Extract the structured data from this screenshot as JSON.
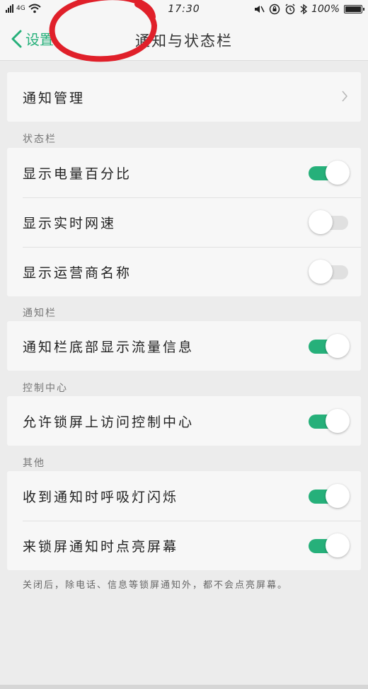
{
  "status_bar": {
    "time": "17:30",
    "battery": "100%",
    "network": "4G"
  },
  "header": {
    "back_label": "设置",
    "title": "通知与状态栏"
  },
  "notification_management": {
    "label": "通知管理"
  },
  "sections": {
    "status_bar": {
      "label": "状态栏",
      "items": [
        {
          "label": "显示电量百分比",
          "on": true
        },
        {
          "label": "显示实时网速",
          "on": false
        },
        {
          "label": "显示运营商名称",
          "on": false
        }
      ]
    },
    "notification_bar": {
      "label": "通知栏",
      "items": [
        {
          "label": "通知栏底部显示流量信息",
          "on": true
        }
      ]
    },
    "control_center": {
      "label": "控制中心",
      "items": [
        {
          "label": "允许锁屏上访问控制中心",
          "on": true
        }
      ]
    },
    "other": {
      "label": "其他",
      "items": [
        {
          "label": "收到通知时呼吸灯闪烁",
          "on": true
        },
        {
          "label": "来锁屏通知时点亮屏幕",
          "on": true
        }
      ]
    }
  },
  "footer_note": "关闭后，除电话、信息等锁屏通知外，都不会点亮屏幕。",
  "colors": {
    "accent": "#26b07a",
    "annotation": "#e0202a"
  }
}
